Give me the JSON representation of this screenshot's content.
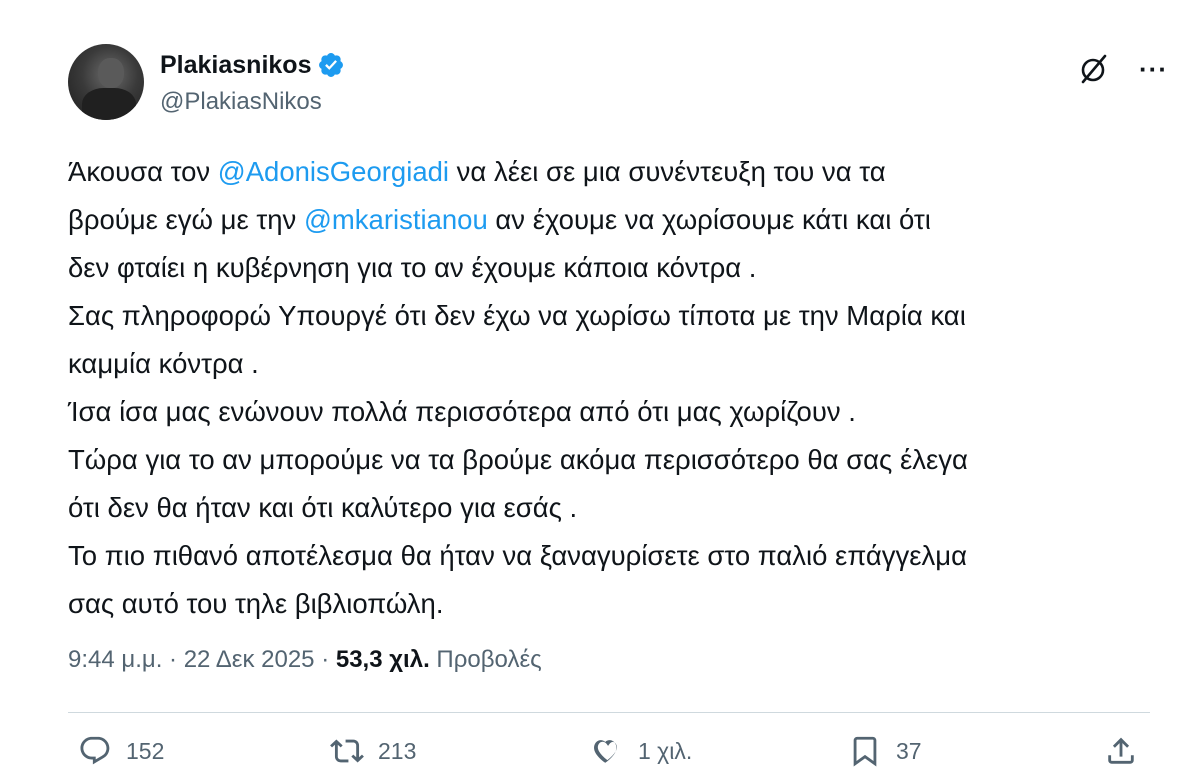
{
  "author": {
    "display_name": "Plakiasnikos",
    "handle": "@PlakiasNikos",
    "verified_icon": "verified-badge-icon"
  },
  "header_actions": {
    "grok_icon": "grok-icon",
    "more_label": "···"
  },
  "tweet": {
    "lines": [
      {
        "pre": "Άκουσα τον ",
        "mention": "@AdonisGeorgiadi",
        "post": " να λέει σε μια συνέντευξη του να τα"
      },
      {
        "pre": "βρούμε εγώ με την ",
        "mention": "@mkaristianou",
        "post": " αν έχουμε να χωρίσουμε κάτι και ότι"
      },
      {
        "text": "δεν φταίει η κυβέρνηση για το αν έχουμε κάποια κόντρα ."
      },
      {
        "text": "Σας πληροφορώ Υπουργέ ότι δεν έχω να χωρίσω τίποτα με την Μαρία και"
      },
      {
        "text": "καμμία κόντρα ."
      },
      {
        "text": "Ίσα ίσα μας ενώνουν πολλά περισσότερα από ότι μας χωρίζουν ."
      },
      {
        "text": "Τώρα για το αν μπορούμε να τα βρούμε ακόμα περισσότερο θα σας έλεγα"
      },
      {
        "text": "ότι δεν θα ήταν και ότι καλύτερο για εσάς ."
      },
      {
        "text": "Το πιο πιθανό αποτέλεσμα θα ήταν να ξαναγυρίσετε στο παλιό επάγγελμα"
      },
      {
        "text": "σας αυτό του τηλε βιβλιοπώλη."
      }
    ]
  },
  "meta": {
    "time": "9:44 μ.μ.",
    "separator": " · ",
    "date": "22 Δεκ 2025",
    "views_count": "53,3 χιλ.",
    "views_label": "Προβολές"
  },
  "actions": {
    "replies": "152",
    "reposts": "213",
    "likes": "1 χιλ.",
    "bookmarks": "37"
  },
  "colors": {
    "mention": "#1d9bf0",
    "secondary_text": "#536471",
    "verified": "#1d9bf0"
  }
}
